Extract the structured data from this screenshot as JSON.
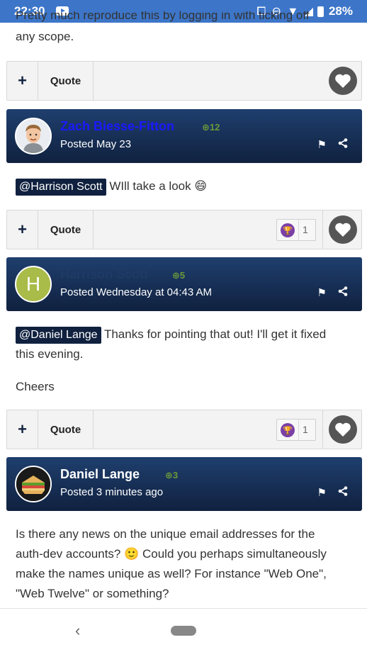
{
  "status_bar": {
    "time": "22:30",
    "icons": "⧠ ⊖ ▼ ◢",
    "battery": "28%"
  },
  "intro_text": {
    "line1": "Pretty much reproduce this by logging in with ticking off",
    "line2": "any scope."
  },
  "action_bars": [
    {
      "plus": "+",
      "quote": "Quote"
    },
    {
      "plus": "+",
      "quote": "Quote",
      "reaction_count": "1"
    },
    {
      "plus": "+",
      "quote": "Quote",
      "reaction_count": "1"
    }
  ],
  "posts": [
    {
      "author": "Zach Biesse-Fitton",
      "author_color": "#1a1aff",
      "reputation": "12",
      "posted": "Posted May 23",
      "mention": "@Harrison Scott",
      "body": "WIll take a look 😄"
    },
    {
      "author": "Harrison Scott",
      "author_color": "#1f3a64",
      "avatar_letter": "H",
      "avatar_color": "#a9bb48",
      "reputation": "5",
      "posted": "Posted Wednesday at 04:43 AM",
      "mention": "@Daniel Lange",
      "body_line1": "Thanks for pointing that out! I'll get it fixed",
      "body_line2": "this evening.",
      "body_line3": "Cheers"
    },
    {
      "author": "Daniel Lange",
      "author_color": "#ffffff",
      "reputation": "3",
      "posted": "Posted 3 minutes ago",
      "body_line1": "Is there any news on the unique email addresses for the",
      "body_line2": "auth-dev accounts? 🙂 Could you perhaps simultaneously",
      "body_line3": "make the names unique as well? For instance \"Web One\",",
      "body_line4": "\"Web Twelve\" or something?"
    }
  ],
  "icons": {
    "plus": "plus-icon",
    "heart": "heart-icon",
    "trophy": "trophy-icon",
    "flag": "flag-icon",
    "share": "share-icon"
  },
  "nav": {
    "back": "‹"
  }
}
